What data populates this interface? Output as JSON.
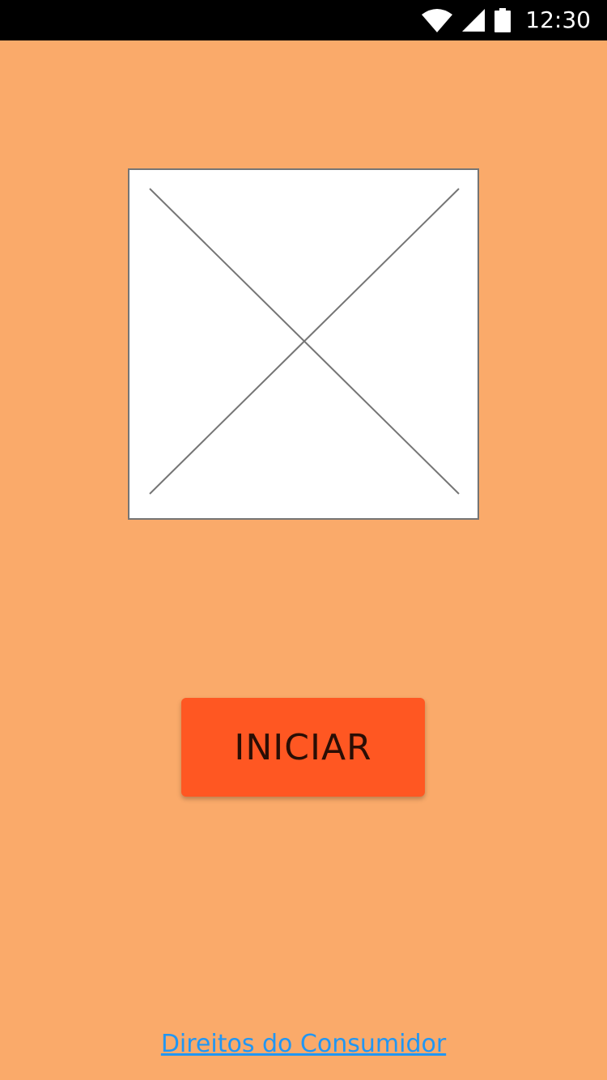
{
  "status_bar": {
    "time": "12:30",
    "icons": [
      "wifi-icon",
      "cellular-signal-icon",
      "battery-icon"
    ]
  },
  "main": {
    "image": {
      "icon": "image-placeholder-icon"
    },
    "start_button": {
      "label": "INICIAR"
    },
    "consumer_rights_link": {
      "label": "Direitos do Consumidor"
    }
  },
  "colors": {
    "background": "#FAAA6A",
    "status_bar": "#000000",
    "button": "#FF5722",
    "button_text": "#2A0E05",
    "link": "#2196F3",
    "placeholder_border": "#757575"
  }
}
